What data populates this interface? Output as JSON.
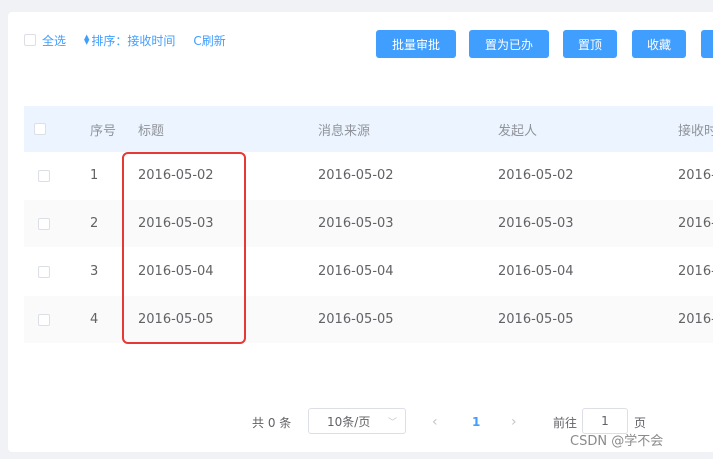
{
  "toolbar": {
    "select_all_label": "全选",
    "sort_label": "排序：接收时间",
    "refresh_label": "C刷新",
    "buttons": [
      "批量审批",
      "置为已办",
      "置顶",
      "收藏"
    ]
  },
  "table": {
    "columns": [
      "序号",
      "标题",
      "消息来源",
      "发起人",
      "接收时"
    ],
    "rows": [
      {
        "index": "1",
        "title": "2016-05-02",
        "source": "2016-05-02",
        "initiator": "2016-05-02",
        "received": "2016-"
      },
      {
        "index": "2",
        "title": "2016-05-03",
        "source": "2016-05-03",
        "initiator": "2016-05-03",
        "received": "2016-"
      },
      {
        "index": "3",
        "title": "2016-05-04",
        "source": "2016-05-04",
        "initiator": "2016-05-04",
        "received": "2016-"
      },
      {
        "index": "4",
        "title": "2016-05-05",
        "source": "2016-05-05",
        "initiator": "2016-05-05",
        "received": "2016-"
      }
    ]
  },
  "pagination": {
    "total_label": "共 0 条",
    "page_size": "10条/页",
    "prev_icon": "chevron-left-icon",
    "current_page": "1",
    "next_icon": "chevron-right-icon",
    "goto_label": "前往",
    "goto_value": "1",
    "page_suffix": "页"
  },
  "watermark": "CSDN @学不会",
  "colors": {
    "accent": "#409eff",
    "header_bg": "#ecf5ff",
    "highlight": "#e53935"
  }
}
